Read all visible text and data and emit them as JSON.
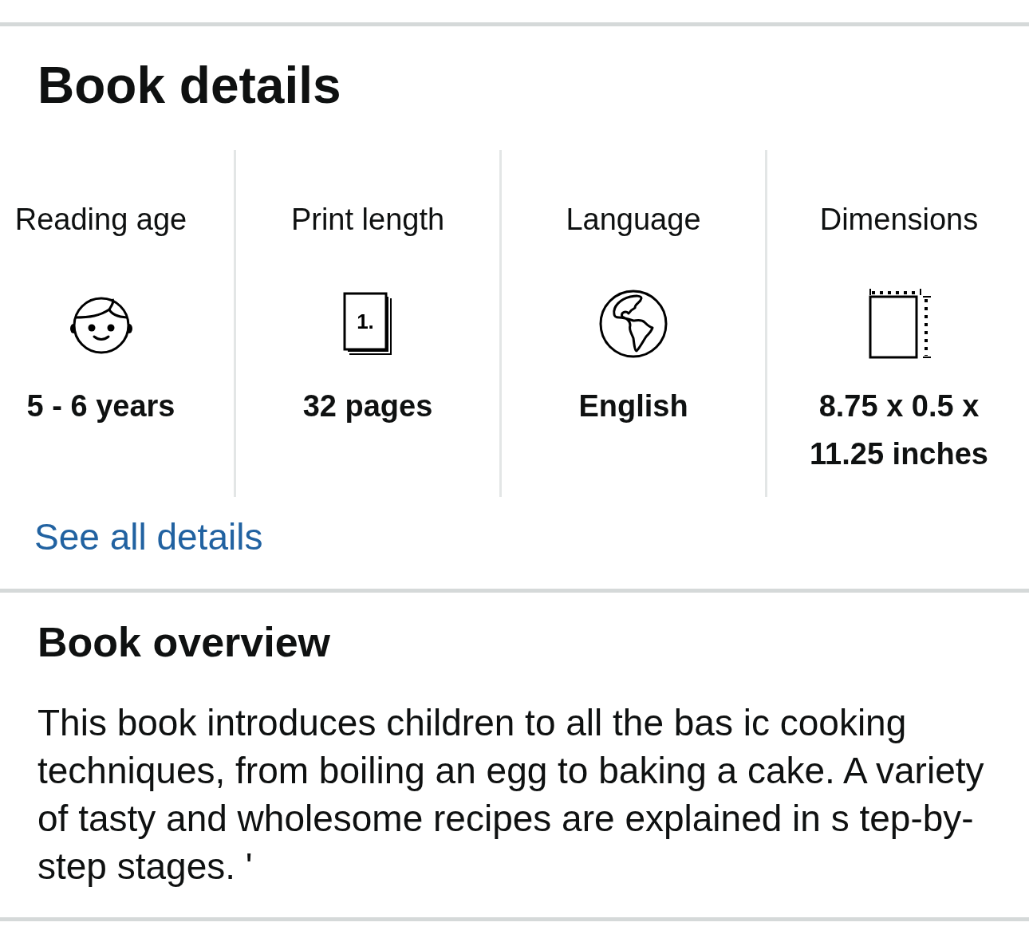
{
  "details_section": {
    "title": "Book details",
    "items": [
      {
        "kind": "reading_age",
        "label": "Reading age",
        "value": "5 - 6 years"
      },
      {
        "kind": "print_length",
        "label": "Print length",
        "icon_label": "1.",
        "value": "32 pages"
      },
      {
        "kind": "language",
        "label": "Language",
        "value": "English"
      },
      {
        "kind": "dimensions",
        "label": "Dimensions",
        "value": "8.75 x 0.5 x 11.25 inches"
      }
    ],
    "link": "See all details"
  },
  "overview": {
    "title": "Book overview",
    "text": "This book introduces children to all the bas ic cooking techniques, from boiling an egg to baking a cake. A variety of tasty and wholesome recipes are explained in s tep-by-step stages. '"
  }
}
